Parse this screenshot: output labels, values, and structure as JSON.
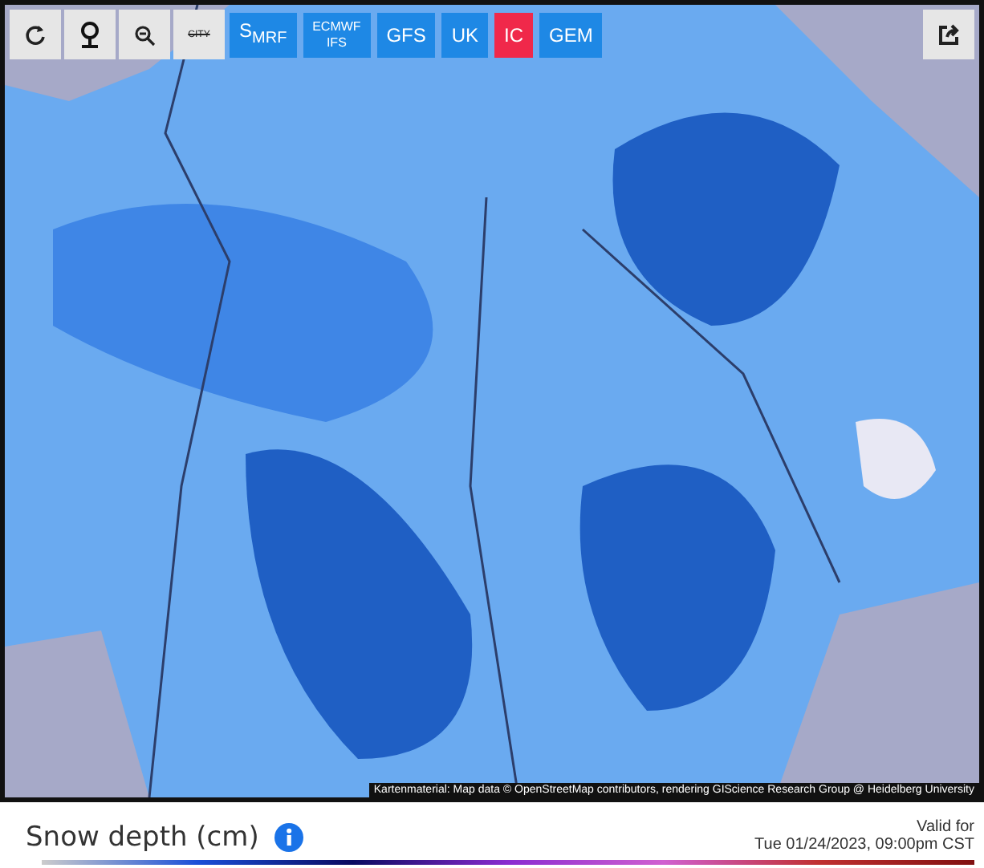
{
  "map_toolbar": {
    "city_toggle_label": "CITY"
  },
  "models": [
    {
      "label": "S$_{MRF}$",
      "selected": false
    },
    {
      "label": "ECMWF IFS",
      "selected": false
    },
    {
      "label": "GFS",
      "selected": false
    },
    {
      "label": "UK",
      "selected": false
    },
    {
      "label": "IC",
      "selected": true
    },
    {
      "label": "GEM",
      "selected": false
    }
  ],
  "attribution": "Kartenmaterial: Map data © OpenStreetMap contributors, rendering GIScience Research Group @ Heidelberg University",
  "title": "Snow depth (cm)",
  "valid_label": "Valid for",
  "valid_time": "Tue 01/24/2023, 09:00pm CST"
}
